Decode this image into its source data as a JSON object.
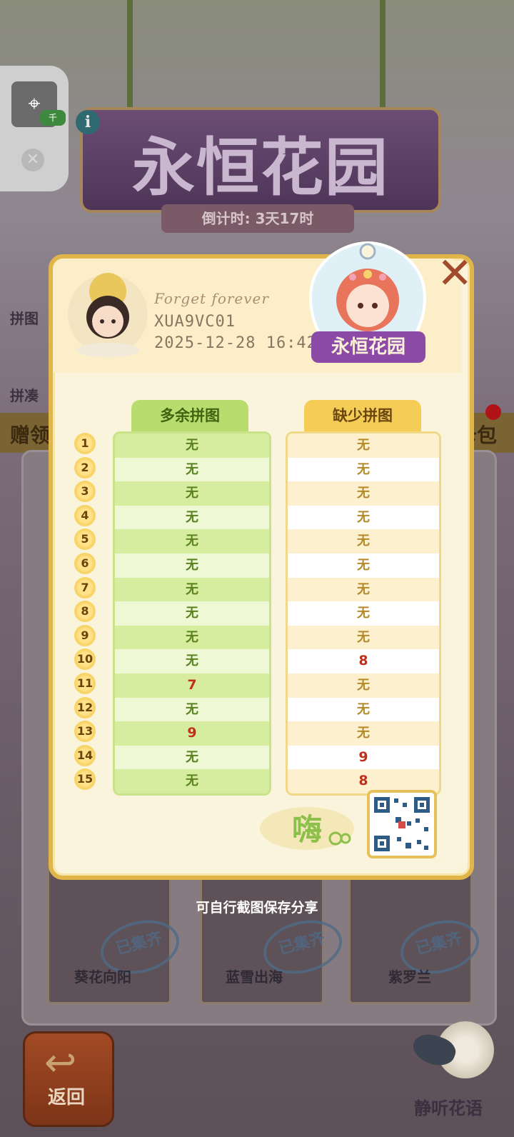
{
  "background": {
    "banner_title": "永恒花园",
    "countdown": "倒计时: 3天17时",
    "side_labels": [
      "拼图",
      "拼凑"
    ],
    "gift_left": "赠领",
    "gift_right": "卡包",
    "cards": [
      {
        "label": "葵花向阳",
        "stamp": "已集齐"
      },
      {
        "label": "蓝雪出海",
        "stamp": "已集齐"
      },
      {
        "label": "紫罗兰",
        "stamp": "已集齐"
      }
    ],
    "back_label": "返回",
    "listen_label": "静听花语"
  },
  "floating_tool": {
    "badge": "千"
  },
  "modal": {
    "user_name": "Forget forever",
    "user_id": "XUA9VC01",
    "timestamp": "2025-12-28 16:42",
    "badge_title": "永恒花园",
    "logo_text": "嗨",
    "columns": {
      "extra_header": "多余拼图",
      "missing_header": "缺少拼图"
    },
    "rows": [
      {
        "n": "1",
        "extra": "无",
        "missing": "无"
      },
      {
        "n": "2",
        "extra": "无",
        "missing": "无"
      },
      {
        "n": "3",
        "extra": "无",
        "missing": "无"
      },
      {
        "n": "4",
        "extra": "无",
        "missing": "无"
      },
      {
        "n": "5",
        "extra": "无",
        "missing": "无"
      },
      {
        "n": "6",
        "extra": "无",
        "missing": "无"
      },
      {
        "n": "7",
        "extra": "无",
        "missing": "无"
      },
      {
        "n": "8",
        "extra": "无",
        "missing": "无"
      },
      {
        "n": "9",
        "extra": "无",
        "missing": "无"
      },
      {
        "n": "10",
        "extra": "无",
        "missing": "8"
      },
      {
        "n": "11",
        "extra": "7",
        "missing": "无"
      },
      {
        "n": "12",
        "extra": "无",
        "missing": "无"
      },
      {
        "n": "13",
        "extra": "9",
        "missing": "无"
      },
      {
        "n": "14",
        "extra": "无",
        "missing": "9"
      },
      {
        "n": "15",
        "extra": "无",
        "missing": "8"
      }
    ],
    "hint": "可自行截图保存分享"
  },
  "colors": {
    "accent_gold": "#e0b64a",
    "extra_green": "#b8dc6d",
    "missing_yellow": "#f5cc55",
    "highlight_red": "#c0311b"
  },
  "icons": [
    "close-icon",
    "info-icon",
    "back-arrow-icon",
    "qr-code-icon",
    "cursor-tool-icon"
  ]
}
